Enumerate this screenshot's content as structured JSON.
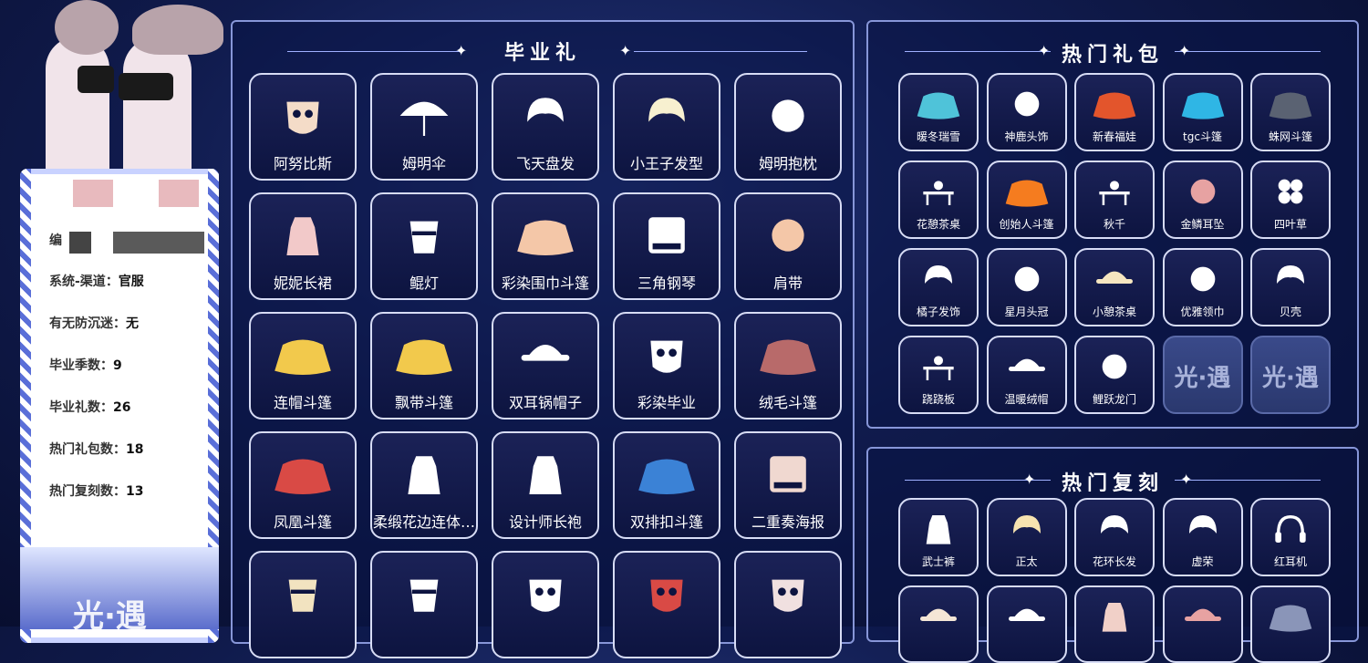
{
  "profile": {
    "id_label": "编",
    "lines": [
      {
        "key": "系统-渠道",
        "value": "官服"
      },
      {
        "key": "有无防沉迷",
        "value": "无"
      },
      {
        "key": "毕业季数",
        "value": "9"
      },
      {
        "key": "毕业礼数",
        "value": "26"
      },
      {
        "key": "热门礼包数",
        "value": "18"
      },
      {
        "key": "热门复刻数",
        "value": "13"
      }
    ],
    "logo_text": "光·遇"
  },
  "graduation": {
    "title": "毕业礼",
    "items": [
      {
        "label": "阿努比斯",
        "icon": "anubis-mask-icon",
        "color": "#f4dcc8"
      },
      {
        "label": "姆明伞",
        "icon": "umbrella-icon",
        "color": "#ffffff"
      },
      {
        "label": "飞天盘发",
        "icon": "hair-bun-icon",
        "color": "#ffffff"
      },
      {
        "label": "小王子发型",
        "icon": "spiky-hair-icon",
        "color": "#f7f0d0"
      },
      {
        "label": "姆明抱枕",
        "icon": "moomin-pillow-icon",
        "color": "#ffffff"
      },
      {
        "label": "妮妮长裙",
        "icon": "dress-icon",
        "color": "#f2c9c9"
      },
      {
        "label": "鲲灯",
        "icon": "lantern-icon",
        "color": "#ffffff"
      },
      {
        "label": "彩染围巾斗篷",
        "icon": "scarf-cape-icon",
        "color": "#f4c7a8"
      },
      {
        "label": "三角钢琴",
        "icon": "piano-icon",
        "color": "#ffffff"
      },
      {
        "label": "肩带",
        "icon": "shoulder-strap-icon",
        "color": "#f4c7a8"
      },
      {
        "label": "连帽斗篷",
        "icon": "hooded-cape-icon",
        "color": "#f2c94c"
      },
      {
        "label": "飘带斗篷",
        "icon": "ribbon-cape-icon",
        "color": "#f2c94c"
      },
      {
        "label": "双耳锅帽子",
        "icon": "pot-hat-icon",
        "color": "#ffffff"
      },
      {
        "label": "彩染毕业",
        "icon": "horned-mask-icon",
        "color": "#ffffff"
      },
      {
        "label": "绒毛斗篷",
        "icon": "fur-cape-icon",
        "color": "#b86a6a"
      },
      {
        "label": "凤凰斗篷",
        "icon": "phoenix-cape-icon",
        "color": "#d94a45"
      },
      {
        "label": "柔缎花边连体…",
        "icon": "lace-jumpsuit-icon",
        "color": "#ffffff"
      },
      {
        "label": "设计师长袍",
        "icon": "designer-robe-icon",
        "color": "#ffffff"
      },
      {
        "label": "双排扣斗篷",
        "icon": "double-breasted-cape-icon",
        "color": "#3b82d6"
      },
      {
        "label": "二重奏海报",
        "icon": "duet-poster-icon",
        "color": "#f0d8d0"
      },
      {
        "label": "",
        "icon": "drum-icon",
        "color": "#f2e3c0"
      },
      {
        "label": "",
        "icon": "horn-icon",
        "color": "#ffffff"
      },
      {
        "label": "",
        "icon": "feather-mask-icon",
        "color": "#ffffff"
      },
      {
        "label": "",
        "icon": "red-mask-icon",
        "color": "#d94a45"
      },
      {
        "label": "",
        "icon": "skull-mask-icon",
        "color": "#f0e0e0"
      }
    ]
  },
  "hot_packs": {
    "title": "热门礼包",
    "items": [
      {
        "label": "暖冬瑞雪",
        "icon": "snow-cape-icon",
        "color": "#4fc3d9"
      },
      {
        "label": "神鹿头饰",
        "icon": "antler-icon",
        "color": "#ffffff"
      },
      {
        "label": "新春福娃",
        "icon": "new-year-cape-icon",
        "color": "#e3552c"
      },
      {
        "label": "tgc斗篷",
        "icon": "tgc-cape-icon",
        "color": "#2fb6e5"
      },
      {
        "label": "蛛网斗篷",
        "icon": "web-cape-icon",
        "color": "#5a6272"
      },
      {
        "label": "花憩茶桌",
        "icon": "tea-table-icon",
        "color": "#ffffff"
      },
      {
        "label": "创始人斗篷",
        "icon": "founder-cape-icon",
        "color": "#f57c1f"
      },
      {
        "label": "秋千",
        "icon": "swing-icon",
        "color": "#ffffff"
      },
      {
        "label": "金鳞耳坠",
        "icon": "earring-icon",
        "color": "#e7a2a2"
      },
      {
        "label": "四叶草",
        "icon": "clover-icon",
        "color": "#ffffff"
      },
      {
        "label": "橘子发饰",
        "icon": "orange-hairpin-icon",
        "color": "#ffffff"
      },
      {
        "label": "星月头冠",
        "icon": "star-moon-crown-icon",
        "color": "#ffffff"
      },
      {
        "label": "小憩茶桌",
        "icon": "teapot-icon",
        "color": "#f6e6c0"
      },
      {
        "label": "优雅领巾",
        "icon": "bow-collar-icon",
        "color": "#ffffff"
      },
      {
        "label": "贝壳",
        "icon": "shell-hairpin-icon",
        "color": "#ffffff"
      },
      {
        "label": "跷跷板",
        "icon": "seesaw-icon",
        "color": "#ffffff"
      },
      {
        "label": "温暖绒帽",
        "icon": "warm-hat-icon",
        "color": "#ffffff"
      },
      {
        "label": "鲤跃龙门",
        "icon": "koi-icon",
        "color": "#ffffff"
      },
      {
        "label": "",
        "locked": true,
        "logo": "光·遇"
      },
      {
        "label": "",
        "locked": true,
        "logo": "光·遇"
      }
    ]
  },
  "hot_reruns": {
    "title": "热门复刻",
    "items": [
      {
        "label": "武士裤",
        "icon": "samurai-pants-icon",
        "color": "#ffffff"
      },
      {
        "label": "正太",
        "icon": "boy-hair-icon",
        "color": "#f7e3b0"
      },
      {
        "label": "花环长发",
        "icon": "flower-wreath-hair-icon",
        "color": "#ffffff"
      },
      {
        "label": "虚荣",
        "icon": "vanity-hair-icon",
        "color": "#ffffff"
      },
      {
        "label": "红耳机",
        "icon": "headphones-icon",
        "color": "#ffffff"
      },
      {
        "label": "",
        "icon": "straw-hat-icon",
        "color": "#f4e6d6"
      },
      {
        "label": "",
        "icon": "pot-icon",
        "color": "#ffffff"
      },
      {
        "label": "",
        "icon": "robe-icon",
        "color": "#f1d0c8"
      },
      {
        "label": "",
        "icon": "mushroom-hat-icon",
        "color": "#e7a2a2"
      },
      {
        "label": "",
        "icon": "cape-icon",
        "color": "#8a95b8"
      }
    ]
  }
}
